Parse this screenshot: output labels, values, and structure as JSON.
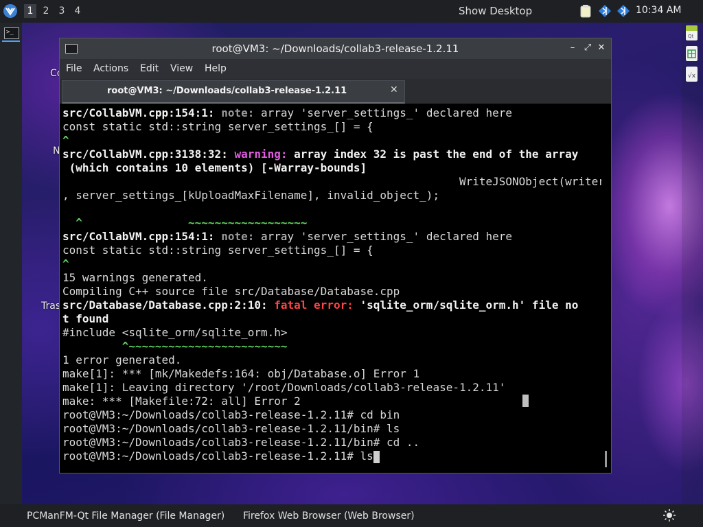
{
  "top_panel": {
    "workspaces": [
      "1",
      "2",
      "3",
      "4"
    ],
    "active_workspace": "1",
    "show_desktop": "Show Desktop",
    "clock": "10:34 AM",
    "tray_icons": [
      "clipboard-icon",
      "network-diamond-icon",
      "bluetooth-diamond-icon"
    ]
  },
  "desktop": {
    "labels": [
      "Co",
      "N",
      "Tras"
    ]
  },
  "right_panel": {
    "icons": [
      "qt-doc-icon",
      "spreadsheet-doc-icon",
      "formula-doc-icon"
    ]
  },
  "window": {
    "title": "root@VM3: ~/Downloads/collab3-release-1.2.11",
    "menu": [
      "File",
      "Actions",
      "Edit",
      "View",
      "Help"
    ],
    "tab_title": "root@VM3: ~/Downloads/collab3-release-1.2.11"
  },
  "terminal": {
    "l1_a": "src/CollabVM.cpp:154:1: ",
    "l1_b": "note:",
    "l1_c": " array 'server_settings_' declared here",
    "l2": "const static std::string server_settings_[] = {",
    "l3": "^",
    "l4_a": "src/CollabVM.cpp:3138:32: ",
    "l4_b": "warning:",
    "l4_c": " array index 32 is past the end of the array",
    "l5": " (which contains 10 elements) [-Warray-bounds]",
    "l6": "                                                            WriteJSONObject(writer",
    "l7": ", server_settings_[kUploadMaxFilename], invalid_object_);",
    "l8": "",
    "l9_a": "  ^",
    "l9_b": "                ~~~~~~~~~~~~~~~~~~",
    "l10_a": "src/CollabVM.cpp:154:1: ",
    "l10_b": "note:",
    "l10_c": " array 'server_settings_' declared here",
    "l11": "const static std::string server_settings_[] = {",
    "l12": "^",
    "l13": "15 warnings generated.",
    "l14": "Compiling C++ source file src/Database/Database.cpp",
    "l15_a": "src/Database/Database.cpp:2:10: ",
    "l15_b": "fatal error:",
    "l15_c": " 'sqlite_orm/sqlite_orm.h' file no",
    "l16": "t found",
    "l17": "#include <sqlite_orm/sqlite_orm.h>",
    "l18": "         ^~~~~~~~~~~~~~~~~~~~~~~~~",
    "l19": "1 error generated.",
    "l20": "make[1]: *** [mk/Makedefs:164: obj/Database.o] Error 1",
    "l21": "make[1]: Leaving directory '/root/Downloads/collab3-release-1.2.11'",
    "l22": "make: *** [Makefile:72: all] Error 2",
    "l23": "root@VM3:~/Downloads/collab3-release-1.2.11# cd bin",
    "l24": "root@VM3:~/Downloads/collab3-release-1.2.11/bin# ls",
    "l25": "root@VM3:~/Downloads/collab3-release-1.2.11/bin# cd ..",
    "l26": "root@VM3:~/Downloads/collab3-release-1.2.11# ls"
  },
  "taskbar": {
    "tasks": [
      "PCManFM-Qt File Manager (File Manager)",
      "Firefox Web Browser (Web Browser)"
    ]
  },
  "colors": {
    "note": "#9a9a9a",
    "warning": "#e25ce2",
    "fatal": "#ff4444",
    "caret": "#5fd45f"
  }
}
